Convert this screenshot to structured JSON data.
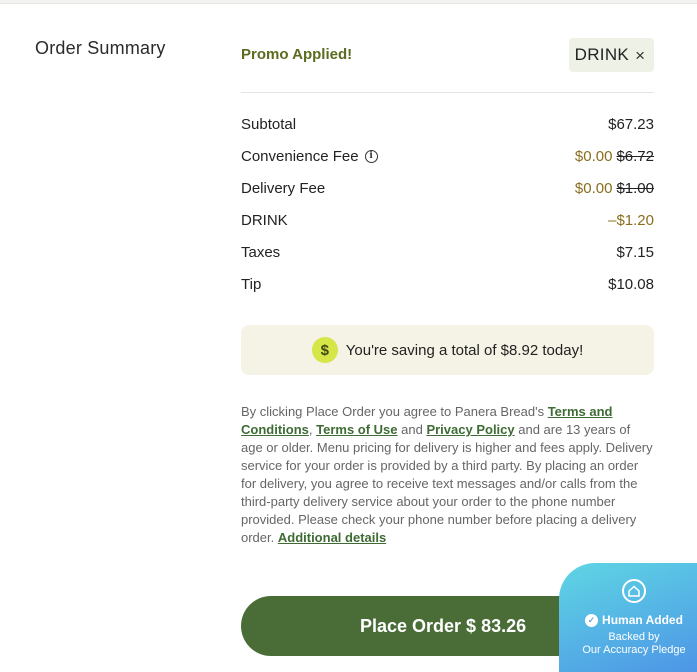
{
  "summary": {
    "title": "Order Summary",
    "promo_label": "Promo Applied!",
    "promo_code": "DRINK",
    "promo_remove_symbol": "×"
  },
  "lines": [
    {
      "label": "Subtotal",
      "amount": "$67.23"
    },
    {
      "label": "Convenience Fee",
      "amount": "$0.00",
      "original": "$6.72",
      "info": "i"
    },
    {
      "label": "Delivery Fee",
      "amount": "$0.00",
      "original": "$1.00"
    },
    {
      "label": "DRINK",
      "amount": "–$1.20"
    },
    {
      "label": "Taxes",
      "amount": "$7.15"
    },
    {
      "label": "Tip",
      "amount": "$10.08"
    }
  ],
  "savings": {
    "icon_symbol": "$",
    "text": "You're saving a total of $8.92 today!"
  },
  "legal": {
    "part1": "By clicking Place Order you agree to Panera Bread's ",
    "terms_conditions": "Terms and Conditions",
    "part2": ", ",
    "terms_use": "Terms of Use",
    "part3": " and ",
    "privacy": "Privacy Policy",
    "part4": " and are 13 years of age or older. Menu pricing for delivery is higher and fees apply. Delivery service for your order is provided by a third party. By placing an order for delivery, you agree to receive text messages and/or calls from the third-party delivery service about your order to the phone number provided. Please check your phone number before placing a delivery order. ",
    "additional": "Additional details"
  },
  "place_order": {
    "label": "Place Order $ 83.26"
  },
  "badge": {
    "title": "Human Added",
    "sub1": "Backed by",
    "sub2": "Our Accuracy Pledge",
    "check_symbol": "✓"
  },
  "colors": {
    "primary_green": "#4a6d38",
    "promo_olive": "#5b6b1f",
    "discount_gold": "#8a6d1d",
    "savings_bg": "#f5f2e6",
    "badge_gradient_start": "#5fd6e4",
    "badge_gradient_end": "#4b8fe6"
  }
}
